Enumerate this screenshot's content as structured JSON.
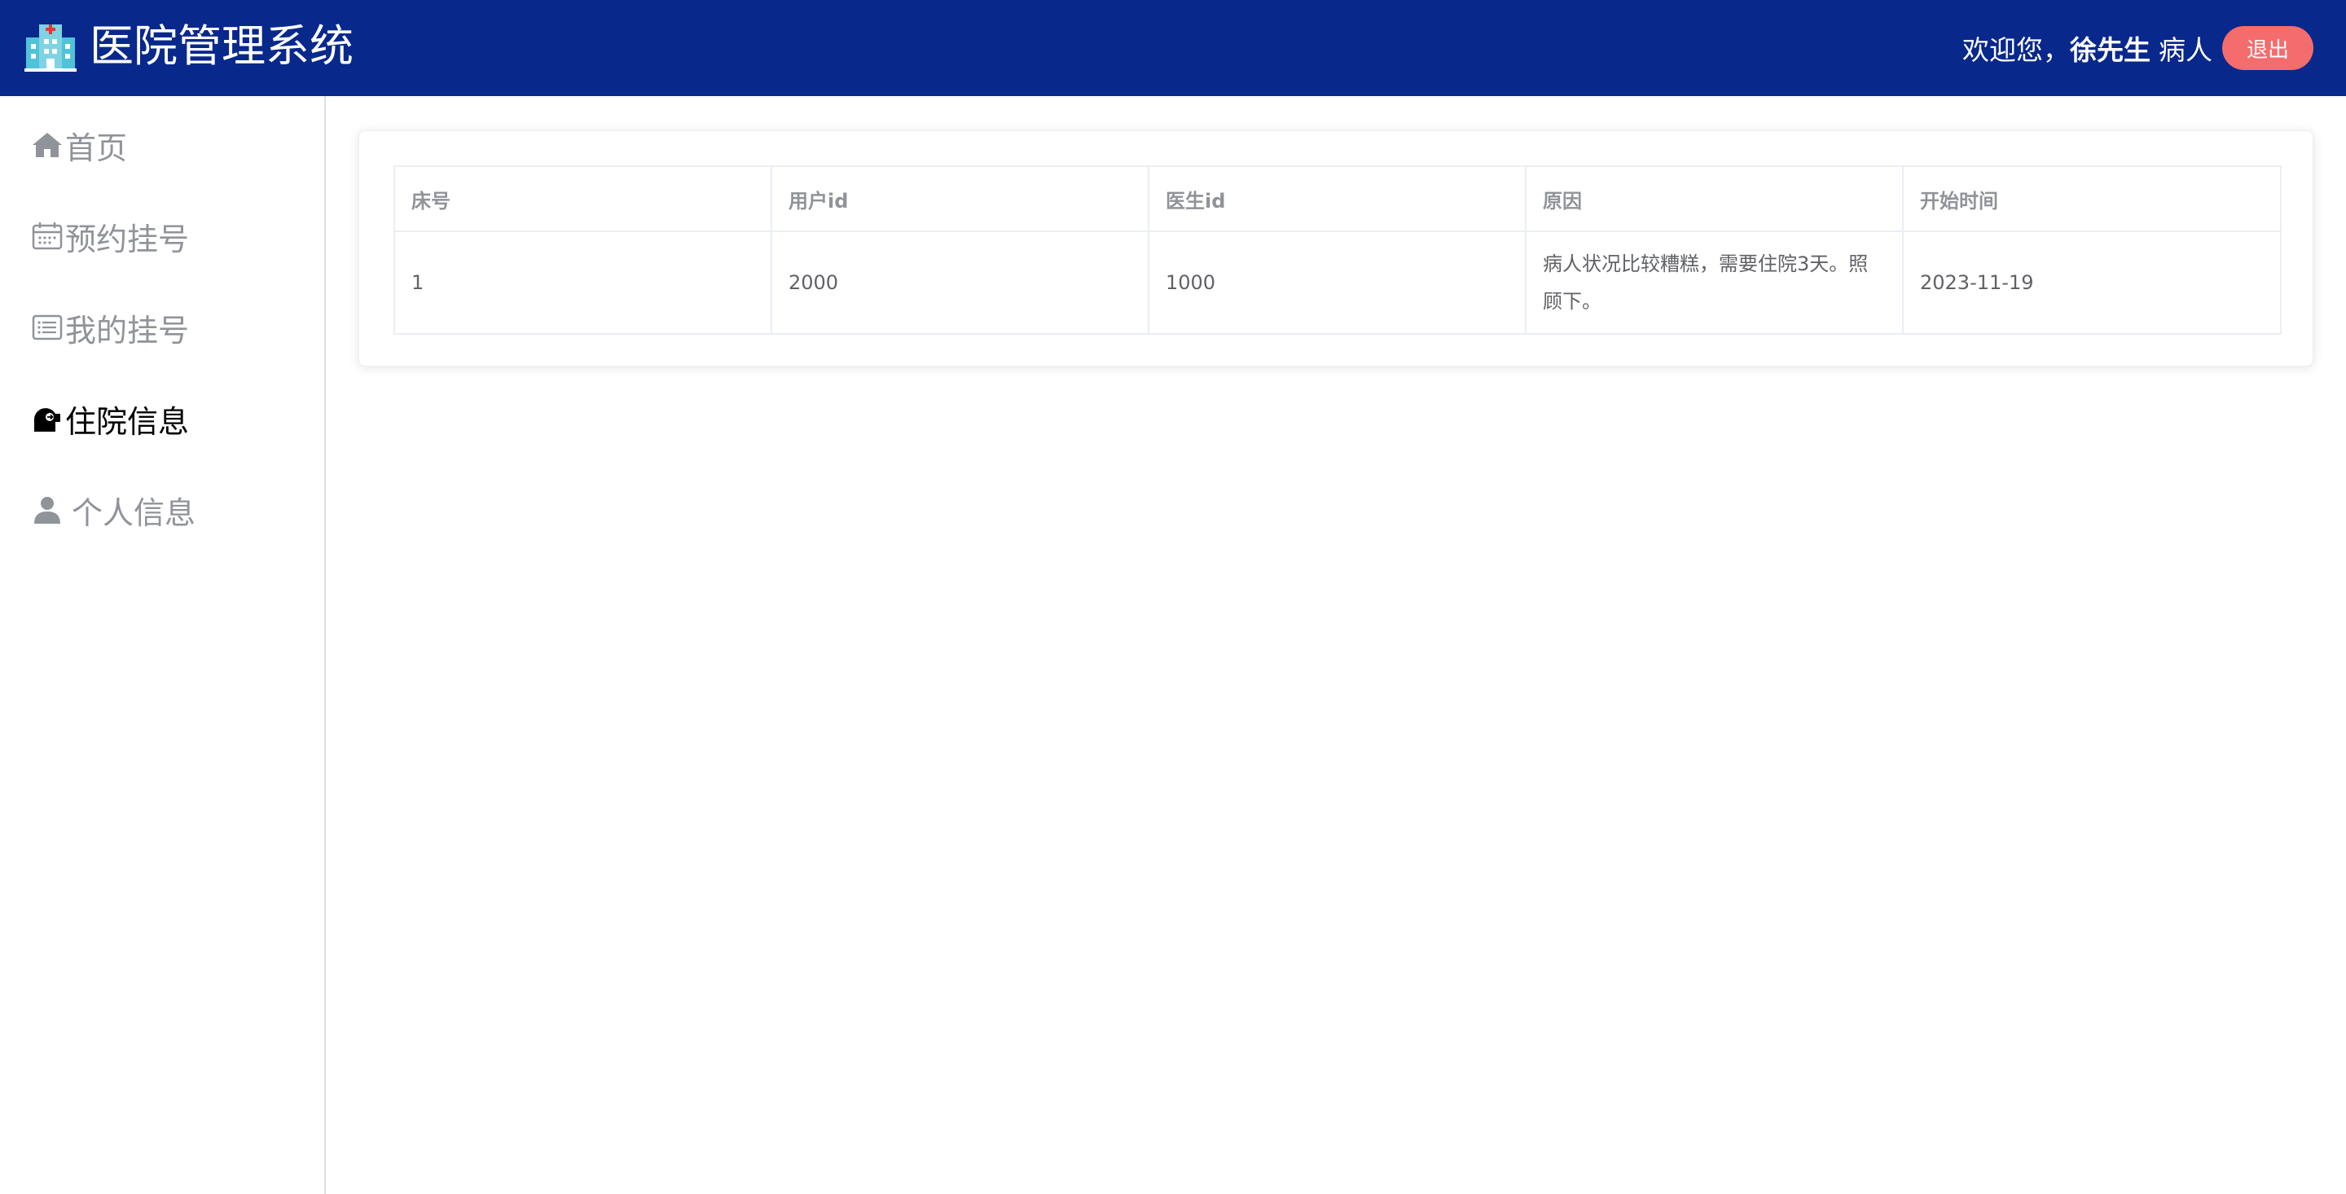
{
  "header": {
    "app_title": "医院管理系统",
    "welcome": "欢迎您，",
    "user_name": "徐先生",
    "user_role": "病人",
    "logout_label": "退出",
    "bg_color": "#08288c",
    "logout_color": "#f56c6c"
  },
  "sidebar": {
    "items": [
      {
        "label": "首页",
        "icon": "home-icon",
        "active": false
      },
      {
        "label": "预约挂号",
        "icon": "calendar-icon",
        "active": false
      },
      {
        "label": "我的挂号",
        "icon": "list-icon",
        "active": false
      },
      {
        "label": "住院信息",
        "icon": "hospitalization-icon",
        "active": true
      },
      {
        "label": "个人信息",
        "icon": "user-icon",
        "active": false
      }
    ]
  },
  "table": {
    "columns": [
      "床号",
      "用户id",
      "医生id",
      "原因",
      "开始时间"
    ],
    "rows": [
      [
        "1",
        "2000",
        "1000",
        "病人状况比较糟糕，需要住院3天。照顾下。",
        "2023-11-19"
      ]
    ]
  }
}
